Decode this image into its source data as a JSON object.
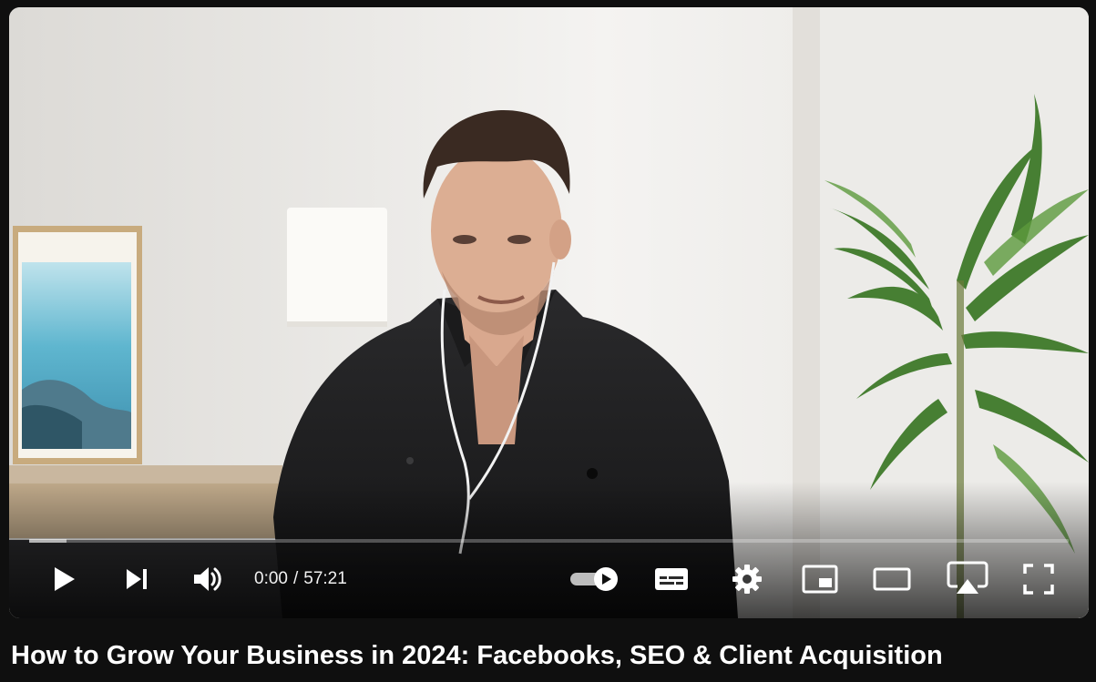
{
  "video": {
    "title": "How to Grow Your Business in 2024: Facebooks, SEO & Client Acquisition",
    "progress_fraction": 0.0,
    "buffered_fraction": 0.036
  },
  "player": {
    "current_time": "0:00",
    "separator": "/",
    "duration": "57:21",
    "autoplay_on": true,
    "accent_color": "#ff0000",
    "icons": {
      "play": "play-icon",
      "next": "next-icon",
      "volume": "volume-icon",
      "autoplay": "autoplay-toggle-icon",
      "subtitles": "subtitles-icon",
      "settings": "gear-icon",
      "miniplayer": "miniplayer-icon",
      "theater": "theater-mode-icon",
      "airplay": "airplay-icon",
      "fullscreen": "fullscreen-icon"
    }
  }
}
